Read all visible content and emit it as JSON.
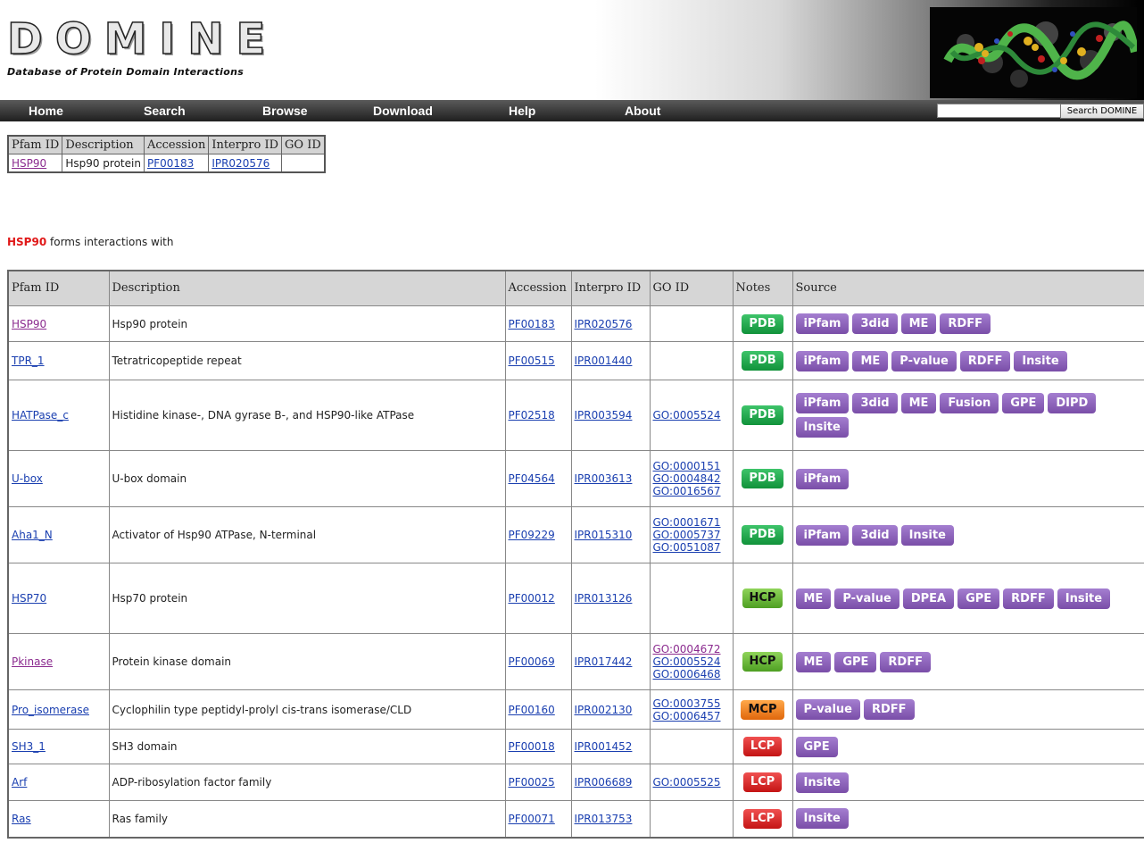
{
  "header": {
    "logo_text": "DOMINE",
    "logo_tagline": "Database of Protein Domain Interactions"
  },
  "nav": [
    "Home",
    "Search",
    "Browse",
    "Download",
    "Help",
    "About"
  ],
  "search": {
    "value": "",
    "button_label": "Search DOMINE"
  },
  "summary": {
    "headers": [
      "Pfam ID",
      "Description",
      "Accession",
      "Interpro ID",
      "GO ID"
    ],
    "row": {
      "pfam": "HSP90",
      "description": "Hsp90 protein",
      "accession": "PF00183",
      "interpro": "IPR020576",
      "go": ""
    }
  },
  "interactions_heading": {
    "highlight": "HSP90",
    "text": " forms interactions with"
  },
  "table": {
    "headers": [
      "Pfam ID",
      "Description",
      "Accession",
      "Interpro ID",
      "GO ID",
      "Notes",
      "Source"
    ],
    "rows": [
      {
        "pfam": "HSP90",
        "visited": true,
        "description": "Hsp90 protein",
        "accession": "PF00183",
        "interpro": "IPR020576",
        "go": [],
        "note": "PDB",
        "sources": [
          "iPfam",
          "3did",
          "ME",
          "RDFF"
        ],
        "h": 40
      },
      {
        "pfam": "TPR_1",
        "visited": false,
        "description": "Tetratricopeptide repeat",
        "accession": "PF00515",
        "interpro": "IPR001440",
        "go": [],
        "note": "PDB",
        "sources": [
          "iPfam",
          "ME",
          "P-value",
          "RDFF",
          "Insite"
        ],
        "h": 43
      },
      {
        "pfam": "HATPase_c",
        "visited": false,
        "description": "Histidine kinase-, DNA gyrase B-, and HSP90-like ATPase",
        "accession": "PF02518",
        "interpro": "IPR003594",
        "go": [
          "GO:0005524"
        ],
        "note": "PDB",
        "sources": [
          "iPfam",
          "3did",
          "ME",
          "Fusion",
          "GPE",
          "DIPD",
          "Insite"
        ],
        "h": 79
      },
      {
        "pfam": "U-box",
        "visited": false,
        "description": "U-box domain",
        "accession": "PF04564",
        "interpro": "IPR003613",
        "go": [
          "GO:0000151",
          "GO:0004842",
          "GO:0016567"
        ],
        "note": "PDB",
        "sources": [
          "iPfam"
        ],
        "h": 63
      },
      {
        "pfam": "Aha1_N",
        "visited": false,
        "description": "Activator of Hsp90 ATPase, N-terminal",
        "accession": "PF09229",
        "interpro": "IPR015310",
        "go": [
          "GO:0001671",
          "GO:0005737",
          "GO:0051087"
        ],
        "note": "PDB",
        "sources": [
          "iPfam",
          "3did",
          "Insite"
        ],
        "h": 63
      },
      {
        "pfam": "HSP70",
        "visited": false,
        "description": "Hsp70 protein",
        "accession": "PF00012",
        "interpro": "IPR013126",
        "go": [],
        "note": "HCP",
        "sources": [
          "ME",
          "P-value",
          "DPEA",
          "GPE",
          "RDFF",
          "Insite"
        ],
        "h": 79
      },
      {
        "pfam": "Pkinase",
        "visited": true,
        "description": "Protein kinase domain",
        "accession": "PF00069",
        "interpro": "IPR017442",
        "go": [
          "GO:0004672",
          "GO:0005524",
          "GO:0006468"
        ],
        "note": "HCP",
        "sources": [
          "ME",
          "GPE",
          "RDFF"
        ],
        "h": 63
      },
      {
        "pfam": "Pro_isomerase",
        "visited": false,
        "description": "Cyclophilin type peptidyl-prolyl cis-trans isomerase/CLD",
        "accession": "PF00160",
        "interpro": "IPR002130",
        "go": [
          "GO:0003755",
          "GO:0006457"
        ],
        "note": "MCP",
        "sources": [
          "P-value",
          "RDFF"
        ],
        "h": 44
      },
      {
        "pfam": "SH3_1",
        "visited": false,
        "description": "SH3 domain",
        "accession": "PF00018",
        "interpro": "IPR001452",
        "go": [],
        "note": "LCP",
        "sources": [
          "GPE"
        ],
        "h": 39
      },
      {
        "pfam": "Arf",
        "visited": false,
        "description": "ADP-ribosylation factor family",
        "accession": "PF00025",
        "interpro": "IPR006689",
        "go": [
          "GO:0005525"
        ],
        "note": "LCP",
        "sources": [
          "Insite"
        ],
        "h": 41
      },
      {
        "pfam": "Ras",
        "visited": false,
        "description": "Ras family",
        "accession": "PF00071",
        "interpro": "IPR013753",
        "go": [],
        "note": "LCP",
        "sources": [
          "Insite"
        ],
        "h": 41
      }
    ]
  },
  "colors": {
    "PDB": "#1aa84a",
    "HCP": "#6cbf3a",
    "MCP": "#f5821f",
    "LCP": "#dd2a2a",
    "source_badge": "#8e62bd",
    "link": "#1a3fb0",
    "visited_link": "#8b2b8f",
    "highlight": "#e01818"
  }
}
